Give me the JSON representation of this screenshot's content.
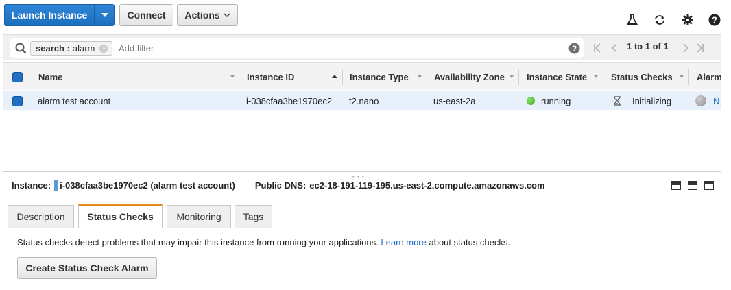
{
  "toolbar": {
    "launch_label": "Launch Instance",
    "connect_label": "Connect",
    "actions_label": "Actions"
  },
  "filter": {
    "token_key": "search :",
    "token_value": "alarm",
    "placeholder": "Add filter",
    "pager_text": "1 to 1 of 1"
  },
  "table": {
    "columns": [
      "Name",
      "Instance ID",
      "Instance Type",
      "Availability Zone",
      "Instance State",
      "Status Checks",
      "Alarm"
    ],
    "rows": [
      {
        "name": "alarm test account",
        "instance_id": "i-038cfaa3be1970ec2",
        "instance_type": "t2.nano",
        "availability_zone": "us-east-2a",
        "instance_state": "running",
        "status_checks": "Initializing",
        "alarm": "N"
      }
    ]
  },
  "detail": {
    "instance_label": "Instance:",
    "instance_value": "i-038cfaa3be1970ec2 (alarm test account)",
    "dns_label": "Public DNS:",
    "dns_value": "ec2-18-191-119-195.us-east-2.compute.amazonaws.com"
  },
  "tabs": [
    "Description",
    "Status Checks",
    "Monitoring",
    "Tags"
  ],
  "active_tab": "Status Checks",
  "status_panel": {
    "help_before": "Status checks detect problems that may impair this instance from running your applications.",
    "help_link": "Learn more",
    "help_after": "about status checks.",
    "create_alarm_label": "Create Status Check Alarm"
  },
  "colors": {
    "primary_blue": "#1c6fbf",
    "running_green": "#4cba29",
    "active_tab_accent": "#e48b1f",
    "link_blue": "#1b6ac9",
    "selected_row": "#e8f1fb"
  },
  "icons": [
    "flask-icon",
    "refresh-icon",
    "gear-icon",
    "help-icon",
    "search-icon",
    "hourglass-icon"
  ]
}
